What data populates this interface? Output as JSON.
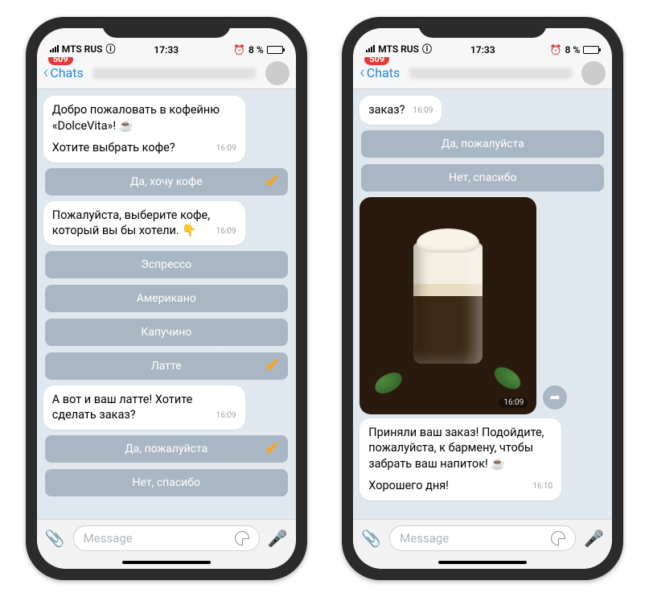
{
  "status": {
    "carrier": "MTS RUS",
    "time": "17:33",
    "battery_pct": "8 %",
    "alarm": "⏰"
  },
  "nav": {
    "back_label": "Chats",
    "badge": "509"
  },
  "input": {
    "placeholder": "Message"
  },
  "left": {
    "msg1": {
      "line1": "Добро пожаловать в кофейню «DolceVita»! ☕",
      "line2": "Хотите выбрать кофе?",
      "ts": "16:09"
    },
    "btn_yes_coffee": "Да, хочу кофе",
    "msg2": {
      "text": "Пожалуйста, выберите кофе, который вы бы хотели. 👇",
      "ts": "16:09"
    },
    "opt_espresso": "Эспрессо",
    "opt_americano": "Американо",
    "opt_cappuccino": "Капучино",
    "opt_latte": "Латте",
    "msg3": {
      "text": "А вот и ваш латте! Хотите сделать заказ?",
      "ts": "16:09"
    },
    "btn_yes_please": "Да, пожалуйста",
    "btn_no_thanks": "Нет, спасибо"
  },
  "right": {
    "msg1": {
      "text": "заказ?",
      "ts": "16:09"
    },
    "btn_yes_please": "Да, пожалуйста",
    "btn_no_thanks": "Нет, спасибо",
    "photo_ts": "16:09",
    "msg2": {
      "line1": "Приняли ваш заказ! Подойдите, пожалуйста, к бармену, чтобы забрать ваш напиток! ☕",
      "line2": "Хорошего дня!",
      "ts": "16:10"
    }
  }
}
